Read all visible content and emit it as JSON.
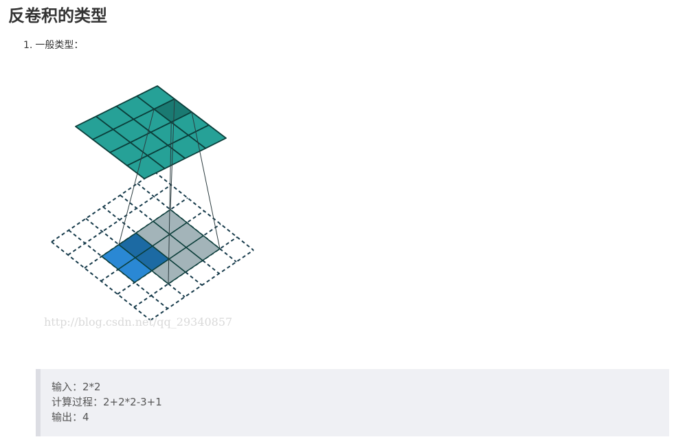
{
  "page": {
    "title": "反卷积的类型"
  },
  "list": {
    "number": "1.",
    "text": "一般类型："
  },
  "figure": {
    "watermark": "http://blog.csdn.net/qq_29340857",
    "colors": {
      "output_grid": "#26a197",
      "output_highlight": "#1a7a72",
      "grid_stroke": "#0b3e3a",
      "kernel_gray": "#9eb0b5",
      "input_blue": "#2a88d4",
      "overlap_blue": "#1c6aa3",
      "dashed_stroke": "#163a4a"
    }
  },
  "code": {
    "lines": [
      "输入：2*2",
      "计算过程：2+2*2-3+1",
      "输出：4"
    ]
  }
}
